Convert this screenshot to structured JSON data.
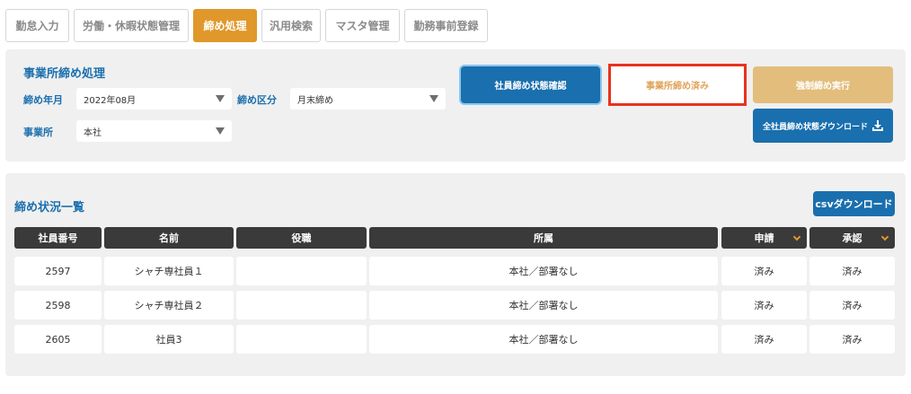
{
  "tabs": [
    {
      "label": "勤怠入力"
    },
    {
      "label": "労働・休暇状態管理"
    },
    {
      "label": "締め処理"
    },
    {
      "label": "汎用検索"
    },
    {
      "label": "マスタ管理"
    },
    {
      "label": "勤務事前登録"
    }
  ],
  "active_tab": "締め処理",
  "closing": {
    "title": "事業所締め処理",
    "period_label": "締め年月",
    "period_value": "2022年08月",
    "type_label": "締め区分",
    "type_value": "月末締め",
    "office_label": "事業所",
    "office_value": "本社",
    "btn_check": "社員締め状態確認",
    "btn_done": "事業所締め済み",
    "btn_force": "強制締め実行",
    "btn_download_all": "全社員締め状態ダウンロード"
  },
  "status": {
    "title": "締め状況一覧",
    "csv_button": "csvダウンロード",
    "columns": [
      "社員番号",
      "名前",
      "役職",
      "所属",
      "申請",
      "承認"
    ],
    "rows": [
      {
        "id": "2597",
        "name": "シャチ専社員１",
        "role": "",
        "dept": "本社／部署なし",
        "apply": "済み",
        "approve": "済み"
      },
      {
        "id": "2598",
        "name": "シャチ専社員２",
        "role": "",
        "dept": "本社／部署なし",
        "apply": "済み",
        "approve": "済み"
      },
      {
        "id": "2605",
        "name": "社員3",
        "role": "",
        "dept": "本社／部署なし",
        "apply": "済み",
        "approve": "済み"
      }
    ]
  },
  "colors": {
    "accent_orange": "#e0982a",
    "primary_blue": "#1a6fae",
    "highlight_red": "#e8321e",
    "header_dark": "#3a3a3a"
  }
}
